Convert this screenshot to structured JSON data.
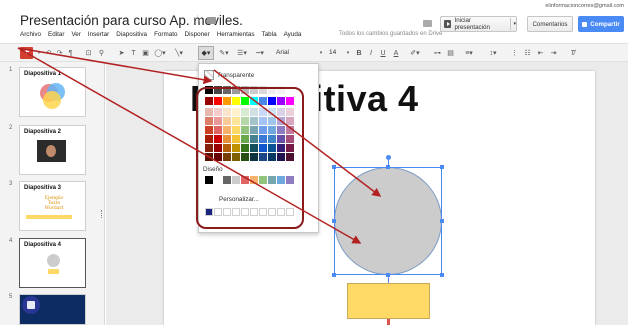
{
  "header": {
    "user_email": "elinformacioncorres@gmail.com",
    "doc_title": "Presentación para curso Ap. moviles.",
    "save_status": "Todos los cambios guardados en Drive",
    "present_label": "Iniciar presentación",
    "comments_label": "Comentarios",
    "share_label": "Compartir"
  },
  "menu": [
    "Archivo",
    "Editar",
    "Ver",
    "Insertar",
    "Diapositiva",
    "Formato",
    "Disponer",
    "Herramientas",
    "Tabla",
    "Ayuda"
  ],
  "toolbar": {
    "font": "Arial",
    "font_size": "14",
    "bold": "B",
    "italic": "I",
    "underline": "U",
    "text_color": "A"
  },
  "slides": [
    {
      "num": "1",
      "title": "Diapositiva 1"
    },
    {
      "num": "2",
      "title": "Diapositiva 2"
    },
    {
      "num": "3",
      "title": "Diapositiva 3",
      "note": "Ejemplo Texto Wordart"
    },
    {
      "num": "4",
      "title": "Diapositiva 4"
    },
    {
      "num": "5",
      "title": ""
    }
  ],
  "canvas": {
    "slide_title": "Diapositiva 4"
  },
  "fill_menu": {
    "transparent_label": "Transparente",
    "design_label": "Diseño",
    "custom_label": "Personalizar...",
    "grays": [
      "#000000",
      "#434343",
      "#666666",
      "#999999",
      "#b7b7b7",
      "#cccccc",
      "#d9d9d9",
      "#efefef",
      "#f3f3f3",
      "#ffffff"
    ],
    "brights": [
      "#980000",
      "#ff0000",
      "#ff9900",
      "#ffff00",
      "#00ff00",
      "#00ffff",
      "#4a86e8",
      "#0000ff",
      "#9900ff",
      "#ff00ff"
    ],
    "tints": [
      [
        "#e6b8af",
        "#f4cccc",
        "#fce5cd",
        "#fff2cc",
        "#d9ead3",
        "#d0e0e3",
        "#c9daf8",
        "#cfe2f3",
        "#d9d2e9",
        "#ead1dc"
      ],
      [
        "#dd7e6b",
        "#ea9999",
        "#f9cb9c",
        "#ffe599",
        "#b6d7a8",
        "#a2c4c9",
        "#a4c2f4",
        "#9fc5e8",
        "#b4a7d6",
        "#d5a6bd"
      ],
      [
        "#cc4125",
        "#e06666",
        "#f6b26b",
        "#ffd966",
        "#93c47d",
        "#76a5af",
        "#6d9eeb",
        "#6fa8dc",
        "#8e7cc3",
        "#c27ba0"
      ],
      [
        "#a61c00",
        "#cc0000",
        "#e69138",
        "#f1c232",
        "#6aa84f",
        "#45818e",
        "#3c78d8",
        "#3d85c6",
        "#674ea7",
        "#a64d79"
      ],
      [
        "#85200c",
        "#990000",
        "#b45f06",
        "#bf9000",
        "#38761d",
        "#134f5c",
        "#1155cc",
        "#0b5394",
        "#351c75",
        "#741b47"
      ],
      [
        "#5b0f00",
        "#660000",
        "#783f04",
        "#7f6000",
        "#274e13",
        "#0c343d",
        "#1c4587",
        "#073763",
        "#20124d",
        "#4c1130"
      ]
    ],
    "design_colors": [
      "#000000",
      "#ffffff",
      "#666666",
      "#cccccc",
      "#e06666",
      "#f6b26b",
      "#93c47d",
      "#76a5af",
      "#6fa8dc",
      "#8e7cc3"
    ],
    "custom_colors": [
      "#1a237e",
      "#ffffff",
      "#ffffff",
      "#ffffff",
      "#ffffff",
      "#ffffff",
      "#ffffff",
      "#ffffff",
      "#ffffff",
      "#ffffff"
    ]
  },
  "colors": {
    "accent_blue": "#4a8af4",
    "red_annotation": "#b22222",
    "shape_gray": "#cccccc",
    "shape_yellow": "#ffd966"
  }
}
